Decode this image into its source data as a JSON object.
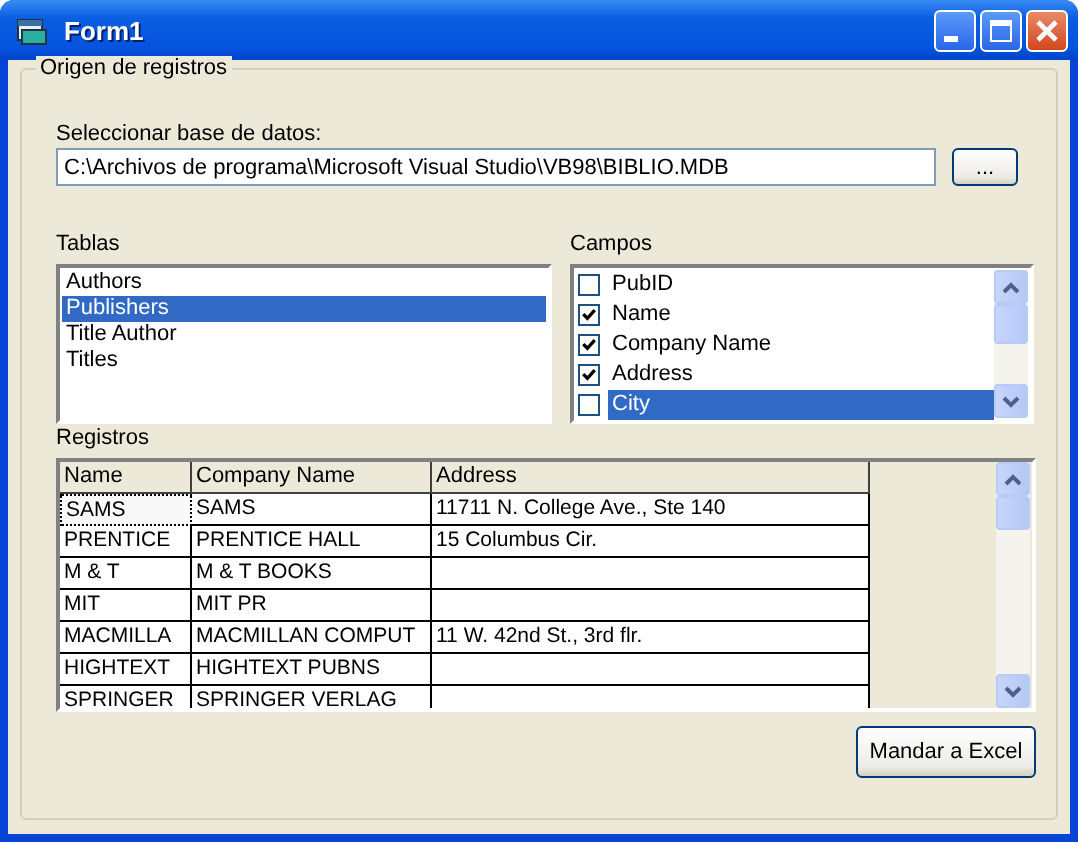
{
  "window": {
    "title": "Form1"
  },
  "group": {
    "title": "Origen de registros"
  },
  "database": {
    "label": "Seleccionar base de datos:",
    "value": "C:\\Archivos de programa\\Microsoft Visual Studio\\VB98\\BIBLIO.MDB",
    "browse_button": "..."
  },
  "tables": {
    "label": "Tablas",
    "items": [
      {
        "label": "Authors",
        "selected": false
      },
      {
        "label": "Publishers",
        "selected": true
      },
      {
        "label": "Title Author",
        "selected": false
      },
      {
        "label": "Titles",
        "selected": false
      }
    ]
  },
  "fields": {
    "label": "Campos",
    "items": [
      {
        "label": "PubID",
        "checked": false,
        "selected": false
      },
      {
        "label": "Name",
        "checked": true,
        "selected": false
      },
      {
        "label": "Company Name",
        "checked": true,
        "selected": false
      },
      {
        "label": "Address",
        "checked": true,
        "selected": false
      },
      {
        "label": "City",
        "checked": false,
        "selected": true
      }
    ]
  },
  "records": {
    "label": "Registros",
    "columns": [
      "Name",
      "Company Name",
      "Address"
    ],
    "rows": [
      {
        "cells": [
          "SAMS",
          "SAMS",
          "11711 N. College Ave., Ste 140"
        ],
        "focused": true
      },
      {
        "cells": [
          "PRENTICE",
          "PRENTICE HALL",
          "15 Columbus Cir."
        ],
        "focused": false
      },
      {
        "cells": [
          "M & T",
          "M & T BOOKS",
          ""
        ],
        "focused": false
      },
      {
        "cells": [
          "MIT",
          "MIT PR",
          ""
        ],
        "focused": false
      },
      {
        "cells": [
          "MACMILLA",
          "MACMILLAN COMPUT",
          "11 W. 42nd St., 3rd flr."
        ],
        "focused": false
      },
      {
        "cells": [
          "HIGHTEXT",
          "HIGHTEXT PUBNS",
          ""
        ],
        "focused": false
      },
      {
        "cells": [
          "SPRINGER",
          "SPRINGER VERLAG",
          ""
        ],
        "focused": false
      }
    ]
  },
  "export_button": "Mandar a Excel"
}
